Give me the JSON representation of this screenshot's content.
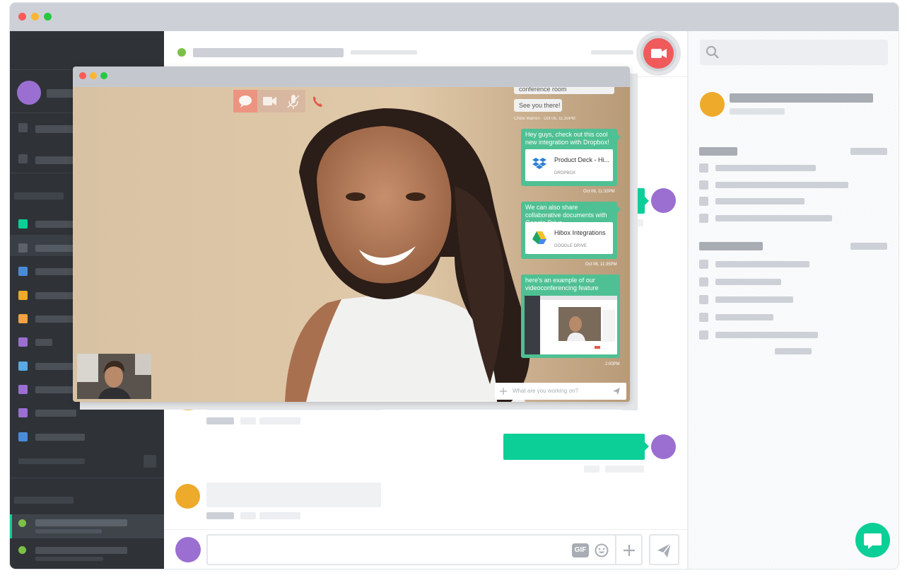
{
  "video_call": {
    "chat_messages": [
      {
        "text": "conference room"
      },
      {
        "text": "See you there!"
      },
      {
        "meta": "Chloe Warren · Oct 06, 11:30PM"
      }
    ],
    "outgoing": [
      {
        "text": "Hey guys, check out this cool new integration with Dropbox!",
        "attachment_title": "Product Deck - Hi...",
        "attachment_source": "DROPBOX",
        "time": "Oct 06, 11:32PM"
      },
      {
        "text": "We can also share collaborative documents with Google Drive",
        "attachment_title": "Hibox Integrations",
        "attachment_source": "GOOGLE DRIVE",
        "time": "Oct 06, 11:35PM"
      },
      {
        "text": "here's an example of our videoconferencing feature",
        "time": "2:00PM"
      }
    ],
    "input_placeholder": "What are you working on?"
  },
  "composer": {
    "gif_label": "GIF"
  },
  "colors": {
    "sidebar_bg": "#2f3338",
    "accent_green": "#0ccf97",
    "avatar_purple": "#9a6fd1",
    "avatar_orange": "#eeaa2a",
    "record_red": "#f05a5a"
  },
  "icons": [
    "video-camera-icon",
    "search-icon",
    "chat-bubble-icon",
    "microphone-off-icon",
    "phone-icon",
    "dropbox-icon",
    "google-drive-icon",
    "plus-icon",
    "send-icon",
    "emoji-icon",
    "chat-support-icon"
  ]
}
